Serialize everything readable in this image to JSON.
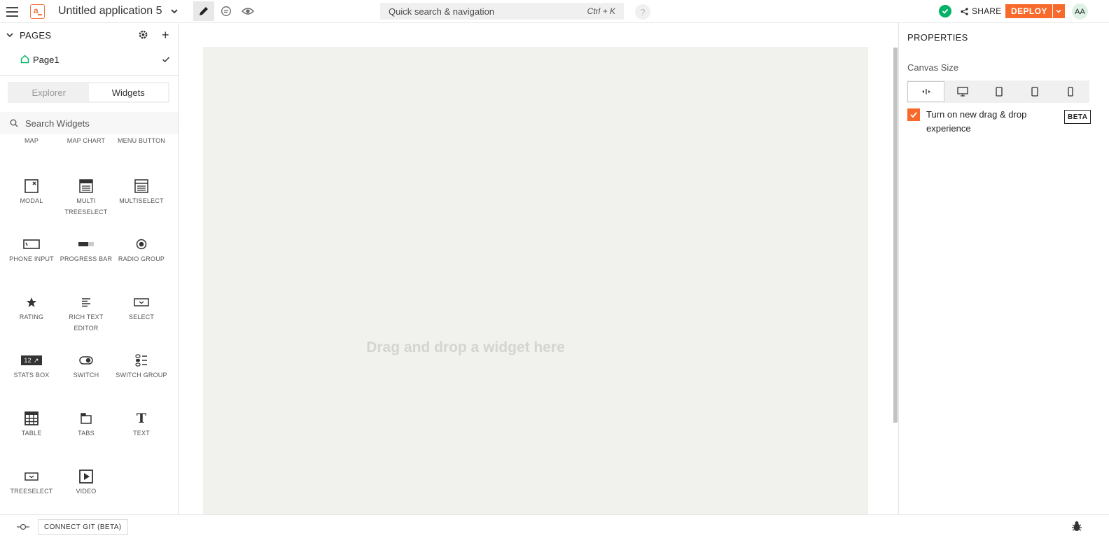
{
  "header": {
    "app_title": "Untitled application 5",
    "logo_letter": "a",
    "search_placeholder": "Quick search & navigation",
    "search_shortcut": "Ctrl + K",
    "help": "?",
    "share_label": "SHARE",
    "deploy_label": "DEPLOY",
    "avatar_initials": "AA",
    "accent": "#f86a2b",
    "status_color": "#03b365"
  },
  "sidebar": {
    "pages_label": "PAGES",
    "pages": [
      {
        "name": "Page1",
        "selected": true
      }
    ],
    "tabs": [
      {
        "label": "Explorer",
        "active": false
      },
      {
        "label": "Widgets",
        "active": true
      }
    ],
    "search_placeholder": "Search Widgets",
    "widgets": [
      {
        "label": "MAP",
        "icon": "map-icon"
      },
      {
        "label": "MAP CHART",
        "icon": "map-chart-icon"
      },
      {
        "label": "MENU BUTTON",
        "icon": "menu-button-icon"
      },
      {
        "label": "MODAL",
        "icon": "modal-icon"
      },
      {
        "label": "MULTI TREESELECT",
        "icon": "multi-treeselect-icon"
      },
      {
        "label": "MULTISELECT",
        "icon": "multiselect-icon"
      },
      {
        "label": "PHONE INPUT",
        "icon": "phone-input-icon"
      },
      {
        "label": "PROGRESS BAR",
        "icon": "progress-bar-icon"
      },
      {
        "label": "RADIO GROUP",
        "icon": "radio-group-icon"
      },
      {
        "label": "RATING",
        "icon": "star-icon"
      },
      {
        "label": "RICH TEXT EDITOR",
        "icon": "rich-text-icon"
      },
      {
        "label": "SELECT",
        "icon": "select-icon"
      },
      {
        "label": "STATS BOX",
        "icon": "stats-box-icon"
      },
      {
        "label": "SWITCH",
        "icon": "switch-icon"
      },
      {
        "label": "SWITCH GROUP",
        "icon": "switch-group-icon"
      },
      {
        "label": "TABLE",
        "icon": "table-icon"
      },
      {
        "label": "TABS",
        "icon": "tabs-icon"
      },
      {
        "label": "TEXT",
        "icon": "text-icon"
      },
      {
        "label": "TREESELECT",
        "icon": "treeselect-icon"
      },
      {
        "label": "VIDEO",
        "icon": "video-icon"
      }
    ],
    "stats_box_number": "12"
  },
  "canvas": {
    "empty_hint": "Drag and drop a widget here"
  },
  "properties": {
    "title": "PROPERTIES",
    "canvas_size_label": "Canvas Size",
    "size_options": [
      "fluid-icon",
      "desktop-icon",
      "tablet-landscape-icon",
      "tablet-icon",
      "mobile-icon"
    ],
    "selected_size": "fluid-icon",
    "dnd_label": "Turn on new drag & drop experience",
    "dnd_checked": true,
    "beta_badge": "BETA"
  },
  "footer": {
    "connect_git_label": "CONNECT GIT (BETA)"
  }
}
